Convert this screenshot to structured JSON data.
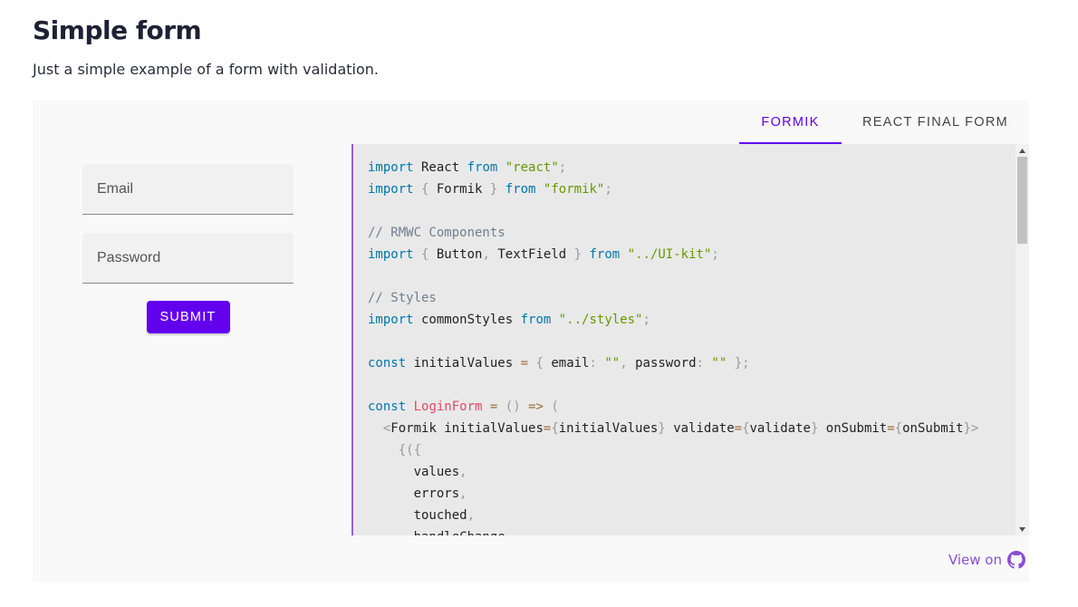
{
  "header": {
    "title": "Simple form",
    "subtitle": "Just a simple example of a form with validation."
  },
  "tabs": [
    {
      "label": "Formik",
      "active": true
    },
    {
      "label": "React Final Form",
      "active": false
    }
  ],
  "form": {
    "email_placeholder": "Email",
    "password_placeholder": "Password",
    "submit_label": "Submit"
  },
  "code": {
    "lines": [
      "import React from \"react\";",
      "import { Formik } from \"formik\";",
      "",
      "// RMWC Components",
      "import { Button, TextField } from \"../UI-kit\";",
      "",
      "// Styles",
      "import commonStyles from \"../styles\";",
      "",
      "const initialValues = { email: \"\", password: \"\" };",
      "",
      "const LoginForm = () => (",
      "  <Formik initialValues={initialValues} validate={validate} onSubmit={onSubmit}>",
      "    {({",
      "      values,",
      "      errors,",
      "      touched,",
      "      handleChange,"
    ]
  },
  "footer": {
    "view_on_label": "View on",
    "icon": "github-icon"
  },
  "colors": {
    "accent": "#6200ee",
    "code_border": "#9a5cd6",
    "link": "#8a4fd0"
  }
}
